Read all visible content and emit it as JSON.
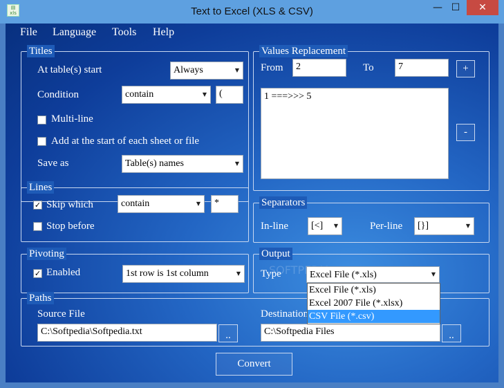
{
  "window": {
    "title": "Text to Excel (XLS & CSV)",
    "minimize": "—",
    "maximize": "☐",
    "close": "✕"
  },
  "menu": {
    "file": "File",
    "language": "Language",
    "tools": "Tools",
    "help": "Help"
  },
  "titles": {
    "legend": "Titles",
    "at_start_label": "At table(s) start",
    "at_start_value": "Always",
    "condition_label": "Condition",
    "condition_value": "contain",
    "condition_text": "(",
    "multiline_label": "Multi-line",
    "multiline_checked": false,
    "add_start_label": "Add at the start of each sheet or file",
    "add_start_checked": false,
    "save_as_label": "Save as",
    "save_as_value": "Table(s) names"
  },
  "values_replacement": {
    "legend": "Values Replacement",
    "from_label": "From",
    "from_value": "2",
    "to_label": "To",
    "to_value": "7",
    "add_button": "+",
    "remove_button": "-",
    "items": [
      "1 ===>>> 5"
    ]
  },
  "lines": {
    "legend": "Lines",
    "skip_label": "Skip which",
    "skip_checked": true,
    "skip_value": "contain",
    "skip_text": "*",
    "stop_label": "Stop before",
    "stop_checked": false
  },
  "separators": {
    "legend": "Separators",
    "inline_label": "In-line",
    "inline_value": "[<]",
    "perline_label": "Per-line",
    "perline_value": "[}]"
  },
  "pivoting": {
    "legend": "Pivoting",
    "enabled_label": "Enabled",
    "enabled_checked": true,
    "mode_value": "1st row is 1st column"
  },
  "output": {
    "legend": "Output",
    "type_label": "Type",
    "type_value": "Excel File (*.xls)",
    "options": [
      "Excel File (*.xls)",
      "Excel 2007 File (*.xlsx)",
      "CSV File (*.csv)"
    ],
    "highlighted_option": "CSV File (*.csv)"
  },
  "paths": {
    "legend": "Paths",
    "source_label": "Source File",
    "source_value": "C:\\Softpedia\\Softpedia.txt",
    "source_browse": "..",
    "dest_label": "Destination",
    "dest_value": "C:\\Softpedia Files",
    "dest_browse": ".."
  },
  "convert_button": "Convert",
  "icons": {
    "app": "excel-app-icon",
    "dropdown": "chevron-down-icon",
    "check": "checkmark-icon"
  }
}
